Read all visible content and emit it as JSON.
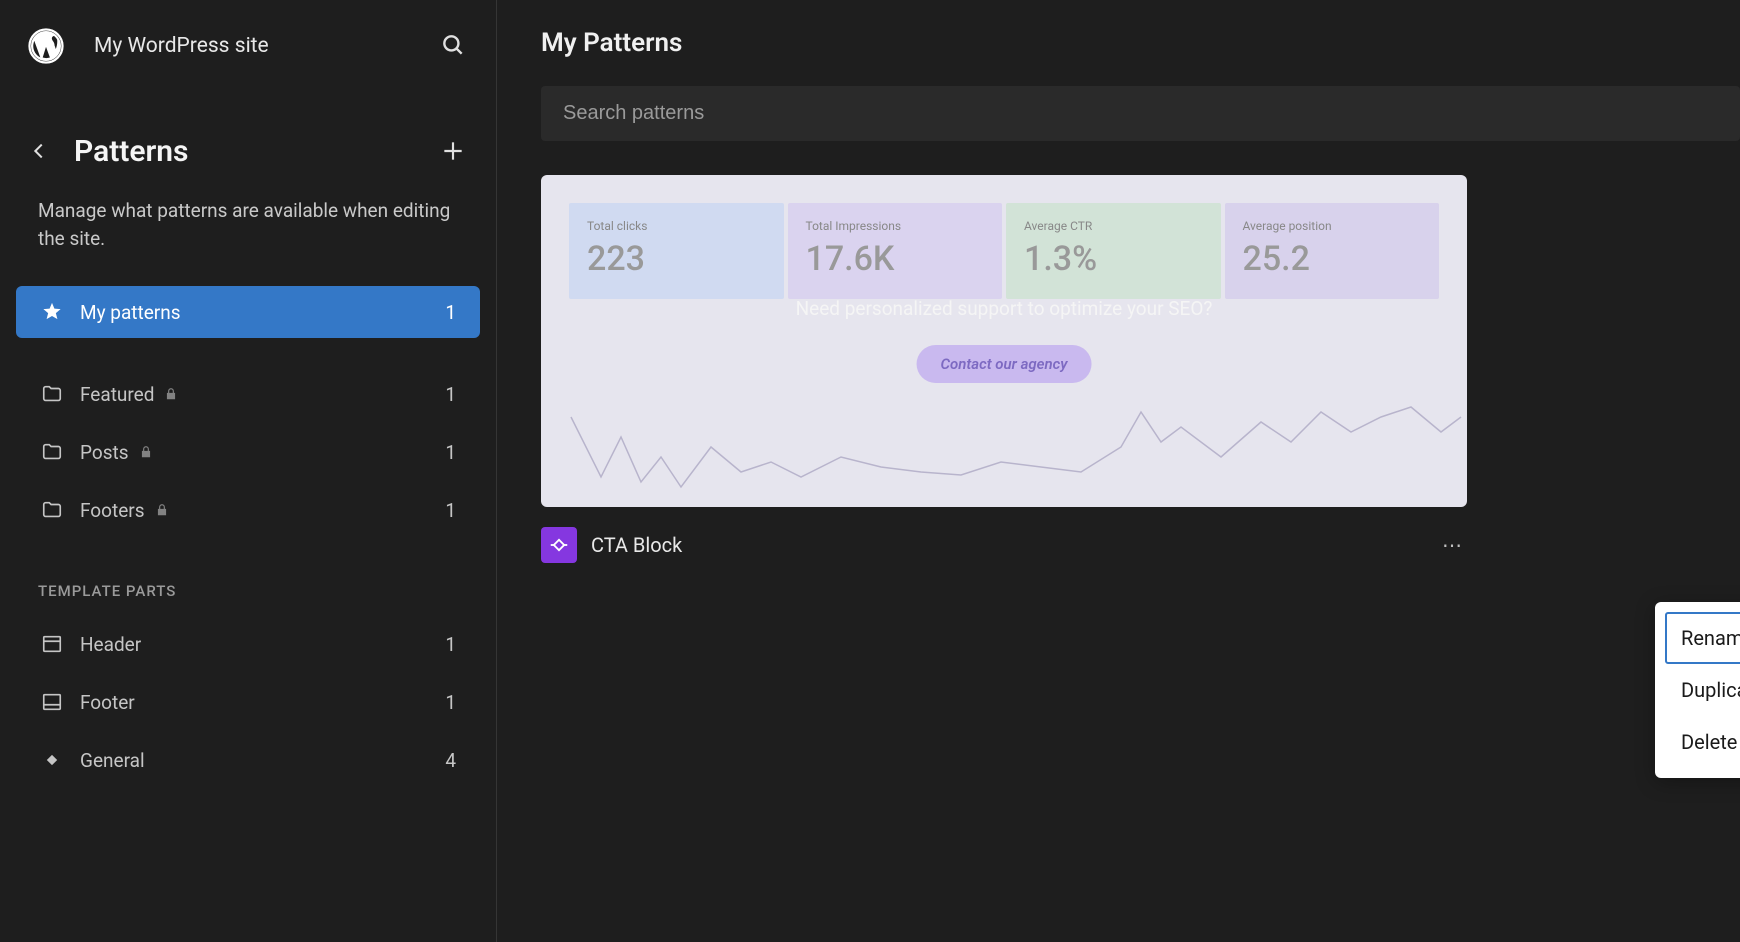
{
  "site_title": "My WordPress site",
  "sidebar": {
    "title": "Patterns",
    "description": "Manage what patterns are available when editing the site.",
    "items": [
      {
        "icon": "star",
        "label": "My patterns",
        "count": "1",
        "active": true,
        "locked": false
      },
      {
        "icon": "folder",
        "label": "Featured",
        "count": "1",
        "active": false,
        "locked": true
      },
      {
        "icon": "folder",
        "label": "Posts",
        "count": "1",
        "active": false,
        "locked": true
      },
      {
        "icon": "folder",
        "label": "Footers",
        "count": "1",
        "active": false,
        "locked": true
      }
    ],
    "templates_heading": "TEMPLATE PARTS",
    "template_items": [
      {
        "icon": "header",
        "label": "Header",
        "count": "1"
      },
      {
        "icon": "footer",
        "label": "Footer",
        "count": "1"
      },
      {
        "icon": "diamond",
        "label": "General",
        "count": "4"
      }
    ]
  },
  "main": {
    "title": "My Patterns",
    "search_placeholder": "Search patterns",
    "pattern": {
      "name": "CTA Block",
      "preview": {
        "stats": [
          {
            "label": "Total clicks",
            "value": "223"
          },
          {
            "label": "Total Impressions",
            "value": "17.6K"
          },
          {
            "label": "Average CTR",
            "value": "1.3%"
          },
          {
            "label": "Average position",
            "value": "25.2"
          }
        ],
        "question": "Need personalized support to optimize your SEO?",
        "button": "Contact our agency"
      }
    }
  },
  "context_menu": {
    "items": [
      {
        "label": "Rename",
        "focused": true
      },
      {
        "label": "Duplicate",
        "focused": false
      },
      {
        "label": "Delete",
        "focused": false
      }
    ]
  }
}
